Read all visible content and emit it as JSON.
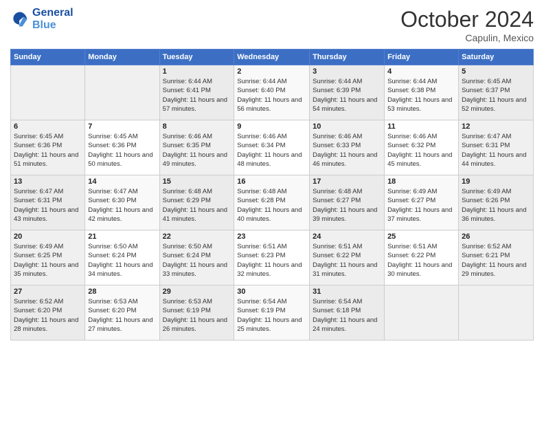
{
  "header": {
    "logo_line1": "General",
    "logo_line2": "Blue",
    "month": "October 2024",
    "location": "Capulin, Mexico"
  },
  "weekdays": [
    "Sunday",
    "Monday",
    "Tuesday",
    "Wednesday",
    "Thursday",
    "Friday",
    "Saturday"
  ],
  "weeks": [
    [
      {
        "day": "",
        "info": ""
      },
      {
        "day": "",
        "info": ""
      },
      {
        "day": "1",
        "info": "Sunrise: 6:44 AM\nSunset: 6:41 PM\nDaylight: 11 hours and 57 minutes."
      },
      {
        "day": "2",
        "info": "Sunrise: 6:44 AM\nSunset: 6:40 PM\nDaylight: 11 hours and 56 minutes."
      },
      {
        "day": "3",
        "info": "Sunrise: 6:44 AM\nSunset: 6:39 PM\nDaylight: 11 hours and 54 minutes."
      },
      {
        "day": "4",
        "info": "Sunrise: 6:44 AM\nSunset: 6:38 PM\nDaylight: 11 hours and 53 minutes."
      },
      {
        "day": "5",
        "info": "Sunrise: 6:45 AM\nSunset: 6:37 PM\nDaylight: 11 hours and 52 minutes."
      }
    ],
    [
      {
        "day": "6",
        "info": "Sunrise: 6:45 AM\nSunset: 6:36 PM\nDaylight: 11 hours and 51 minutes."
      },
      {
        "day": "7",
        "info": "Sunrise: 6:45 AM\nSunset: 6:36 PM\nDaylight: 11 hours and 50 minutes."
      },
      {
        "day": "8",
        "info": "Sunrise: 6:46 AM\nSunset: 6:35 PM\nDaylight: 11 hours and 49 minutes."
      },
      {
        "day": "9",
        "info": "Sunrise: 6:46 AM\nSunset: 6:34 PM\nDaylight: 11 hours and 48 minutes."
      },
      {
        "day": "10",
        "info": "Sunrise: 6:46 AM\nSunset: 6:33 PM\nDaylight: 11 hours and 46 minutes."
      },
      {
        "day": "11",
        "info": "Sunrise: 6:46 AM\nSunset: 6:32 PM\nDaylight: 11 hours and 45 minutes."
      },
      {
        "day": "12",
        "info": "Sunrise: 6:47 AM\nSunset: 6:31 PM\nDaylight: 11 hours and 44 minutes."
      }
    ],
    [
      {
        "day": "13",
        "info": "Sunrise: 6:47 AM\nSunset: 6:31 PM\nDaylight: 11 hours and 43 minutes."
      },
      {
        "day": "14",
        "info": "Sunrise: 6:47 AM\nSunset: 6:30 PM\nDaylight: 11 hours and 42 minutes."
      },
      {
        "day": "15",
        "info": "Sunrise: 6:48 AM\nSunset: 6:29 PM\nDaylight: 11 hours and 41 minutes."
      },
      {
        "day": "16",
        "info": "Sunrise: 6:48 AM\nSunset: 6:28 PM\nDaylight: 11 hours and 40 minutes."
      },
      {
        "day": "17",
        "info": "Sunrise: 6:48 AM\nSunset: 6:27 PM\nDaylight: 11 hours and 39 minutes."
      },
      {
        "day": "18",
        "info": "Sunrise: 6:49 AM\nSunset: 6:27 PM\nDaylight: 11 hours and 37 minutes."
      },
      {
        "day": "19",
        "info": "Sunrise: 6:49 AM\nSunset: 6:26 PM\nDaylight: 11 hours and 36 minutes."
      }
    ],
    [
      {
        "day": "20",
        "info": "Sunrise: 6:49 AM\nSunset: 6:25 PM\nDaylight: 11 hours and 35 minutes."
      },
      {
        "day": "21",
        "info": "Sunrise: 6:50 AM\nSunset: 6:24 PM\nDaylight: 11 hours and 34 minutes."
      },
      {
        "day": "22",
        "info": "Sunrise: 6:50 AM\nSunset: 6:24 PM\nDaylight: 11 hours and 33 minutes."
      },
      {
        "day": "23",
        "info": "Sunrise: 6:51 AM\nSunset: 6:23 PM\nDaylight: 11 hours and 32 minutes."
      },
      {
        "day": "24",
        "info": "Sunrise: 6:51 AM\nSunset: 6:22 PM\nDaylight: 11 hours and 31 minutes."
      },
      {
        "day": "25",
        "info": "Sunrise: 6:51 AM\nSunset: 6:22 PM\nDaylight: 11 hours and 30 minutes."
      },
      {
        "day": "26",
        "info": "Sunrise: 6:52 AM\nSunset: 6:21 PM\nDaylight: 11 hours and 29 minutes."
      }
    ],
    [
      {
        "day": "27",
        "info": "Sunrise: 6:52 AM\nSunset: 6:20 PM\nDaylight: 11 hours and 28 minutes."
      },
      {
        "day": "28",
        "info": "Sunrise: 6:53 AM\nSunset: 6:20 PM\nDaylight: 11 hours and 27 minutes."
      },
      {
        "day": "29",
        "info": "Sunrise: 6:53 AM\nSunset: 6:19 PM\nDaylight: 11 hours and 26 minutes."
      },
      {
        "day": "30",
        "info": "Sunrise: 6:54 AM\nSunset: 6:19 PM\nDaylight: 11 hours and 25 minutes."
      },
      {
        "day": "31",
        "info": "Sunrise: 6:54 AM\nSunset: 6:18 PM\nDaylight: 11 hours and 24 minutes."
      },
      {
        "day": "",
        "info": ""
      },
      {
        "day": "",
        "info": ""
      }
    ]
  ]
}
